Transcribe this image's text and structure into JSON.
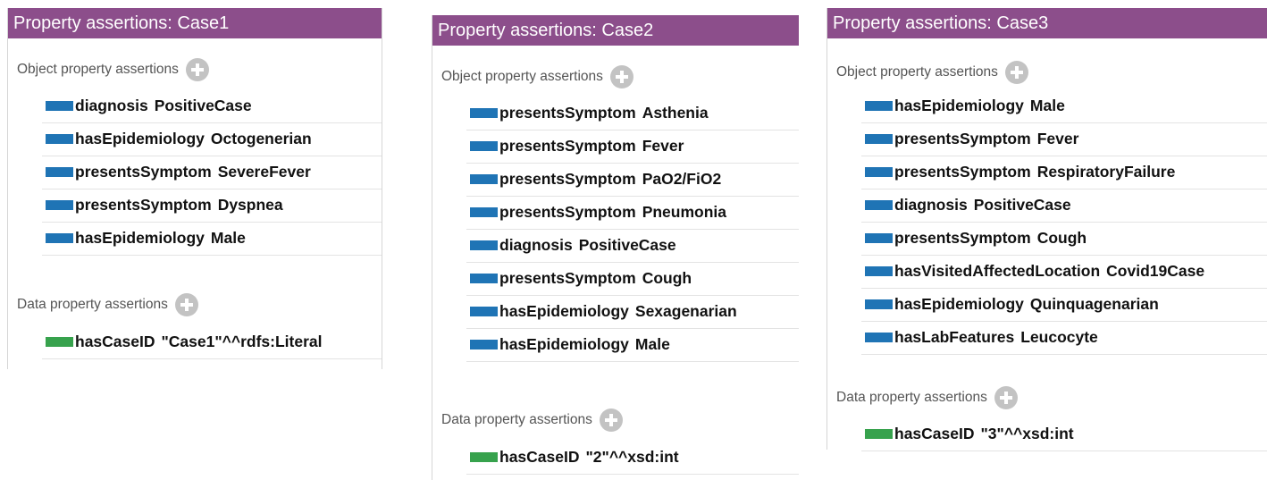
{
  "panels": [
    {
      "title": "Property assertions: Case1",
      "object_section_label": "Object property assertions",
      "object_assertions": [
        {
          "property": "diagnosis",
          "value": "PositiveCase"
        },
        {
          "property": "hasEpidemiology",
          "value": "Octogenerian"
        },
        {
          "property": "presentsSymptom",
          "value": "SevereFever"
        },
        {
          "property": "presentsSymptom",
          "value": "Dyspnea"
        },
        {
          "property": "hasEpidemiology",
          "value": "Male"
        }
      ],
      "data_section_label": "Data property assertions",
      "data_assertions": [
        {
          "property": "hasCaseID",
          "value": "\"Case1\"^^rdfs:Literal"
        }
      ]
    },
    {
      "title": "Property assertions: Case2",
      "object_section_label": "Object property assertions",
      "object_assertions": [
        {
          "property": "presentsSymptom",
          "value": "Asthenia"
        },
        {
          "property": "presentsSymptom",
          "value": "Fever"
        },
        {
          "property": "presentsSymptom",
          "value": "PaO2/FiO2"
        },
        {
          "property": "presentsSymptom",
          "value": "Pneumonia"
        },
        {
          "property": "diagnosis",
          "value": "PositiveCase"
        },
        {
          "property": "presentsSymptom",
          "value": "Cough"
        },
        {
          "property": "hasEpidemiology",
          "value": "Sexagenarian"
        },
        {
          "property": "hasEpidemiology",
          "value": "Male"
        }
      ],
      "data_section_label": "Data property assertions",
      "data_assertions": [
        {
          "property": "hasCaseID",
          "value": "\"2\"^^xsd:int"
        }
      ]
    },
    {
      "title": "Property assertions: Case3",
      "object_section_label": "Object property assertions",
      "object_assertions": [
        {
          "property": "hasEpidemiology",
          "value": "Male"
        },
        {
          "property": "presentsSymptom",
          "value": "Fever"
        },
        {
          "property": "presentsSymptom",
          "value": "RespiratoryFailure"
        },
        {
          "property": "diagnosis",
          "value": "PositiveCase"
        },
        {
          "property": "presentsSymptom",
          "value": "Cough"
        },
        {
          "property": "hasVisitedAffectedLocation",
          "value": "Covid19Case"
        },
        {
          "property": "hasEpidemiology",
          "value": "Quinquagenarian"
        },
        {
          "property": "hasLabFeatures",
          "value": "Leucocyte"
        }
      ],
      "data_section_label": "Data property assertions",
      "data_assertions": [
        {
          "property": "hasCaseID",
          "value": "\"3\"^^xsd:int"
        }
      ]
    }
  ],
  "colors": {
    "header": "#8c4e8b",
    "object_chip": "#1f74b5",
    "data_chip": "#37a24d"
  }
}
